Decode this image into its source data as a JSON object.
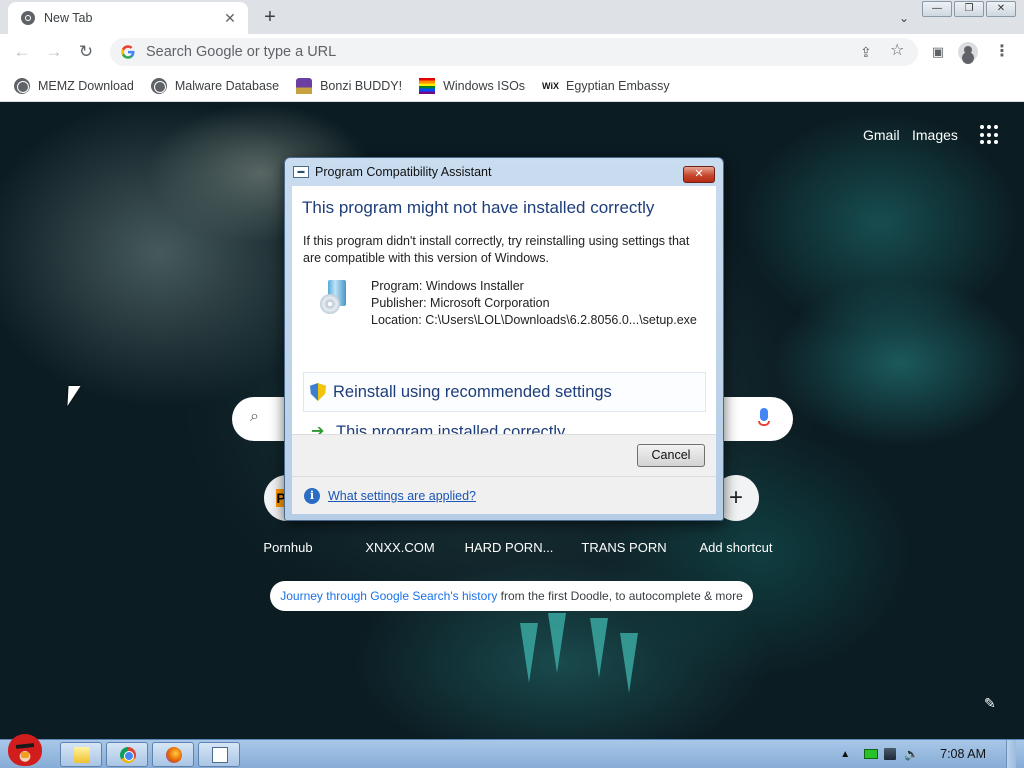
{
  "browser": {
    "tab": {
      "title": "New Tab",
      "close": "✕"
    },
    "new_tab": "+",
    "window_controls": {
      "minimize": "—",
      "restore": "❐",
      "close": "✕"
    },
    "omnibox_placeholder": "Search Google or type a URL",
    "bookmarks": [
      {
        "label": "MEMZ Download",
        "icon": "globe-icon"
      },
      {
        "label": "Malware Database",
        "icon": "globe-icon"
      },
      {
        "label": "Bonzi BUDDY!",
        "icon": "bonzi-icon"
      },
      {
        "label": "Windows ISOs",
        "icon": "rainbow-flag-icon"
      },
      {
        "label": "Egyptian Embassy",
        "icon": "wix-icon",
        "icon_text": "WiX"
      }
    ]
  },
  "newtab": {
    "gmail": "Gmail",
    "images": "Images",
    "shortcuts": [
      {
        "label": "Pornhub"
      },
      {
        "label": "XNXX.COM"
      },
      {
        "label": "HARD PORN..."
      },
      {
        "label": "TRANS PORN"
      },
      {
        "label": "Add shortcut"
      }
    ],
    "doodle": {
      "link": "Journey through Google Search's history",
      "text": " from the first Doodle, to autocomplete & more"
    }
  },
  "dialog": {
    "title": "Program Compatibility Assistant",
    "heading": "This program might not have installed correctly",
    "description": "If this program didn't install correctly, try reinstalling using settings that are compatible with this version of Windows.",
    "program": "Program: Windows Installer",
    "publisher": "Publisher: Microsoft Corporation",
    "location": "Location: C:\\Users\\LOL\\Downloads\\6.2.8056.0...\\setup.exe",
    "option_reinstall": "Reinstall using recommended settings",
    "option_installed": "This program installed correctly",
    "cancel": "Cancel",
    "settings_link": "What settings are applied?"
  },
  "taskbar": {
    "clock": "7:08 AM"
  },
  "colors": {
    "chrome_tabstrip": "#dee1e6",
    "dialog_heading": "#1e3d7b",
    "link_blue": "#1a73e8",
    "taskbar": "#a9c7e8"
  }
}
